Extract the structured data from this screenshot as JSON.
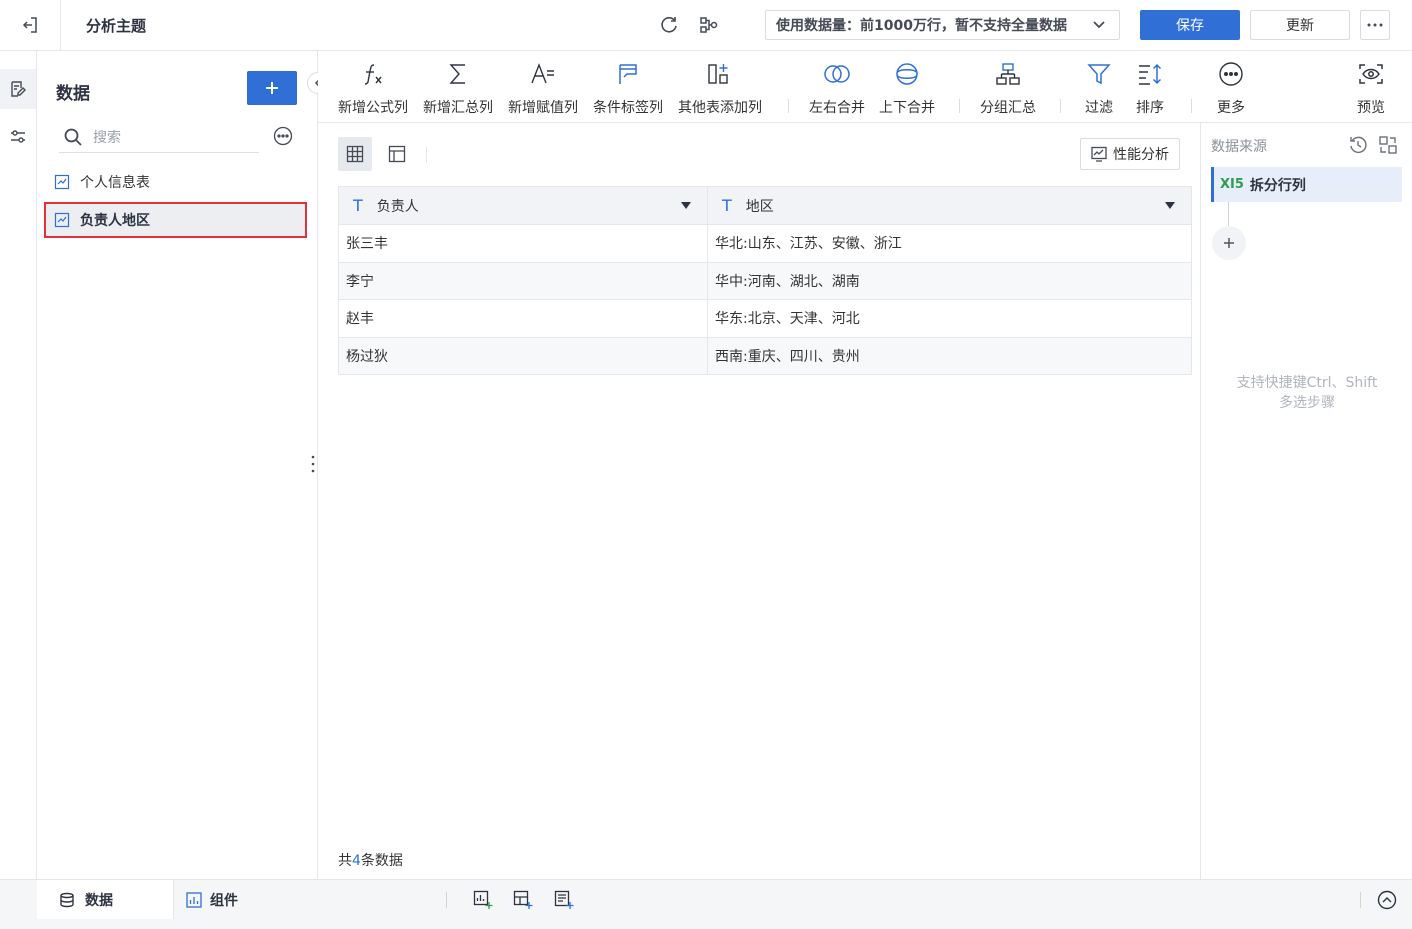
{
  "header": {
    "title": "分析主题",
    "data_volume": "使用数据量：前1000万行，暂不支持全量数据",
    "save_label": "保存",
    "update_label": "更新"
  },
  "data_panel": {
    "title": "数据",
    "search_placeholder": "搜索",
    "items": [
      {
        "label": "个人信息表"
      },
      {
        "label": "负责人地区"
      }
    ]
  },
  "toolbar": {
    "items": [
      {
        "label": "新增公式列",
        "icon": "formula-icon"
      },
      {
        "label": "新增汇总列",
        "icon": "sigma-icon"
      },
      {
        "label": "新增赋值列",
        "icon": "assign-icon"
      },
      {
        "label": "条件标签列",
        "icon": "flag-icon"
      },
      {
        "label": "其他表添加列",
        "icon": "add-column-icon"
      },
      {
        "label": "左右合并",
        "icon": "merge-horizontal-icon"
      },
      {
        "label": "上下合并",
        "icon": "merge-vertical-icon"
      },
      {
        "label": "分组汇总",
        "icon": "group-icon"
      },
      {
        "label": "过滤",
        "icon": "filter-icon"
      },
      {
        "label": "排序",
        "icon": "sort-icon"
      },
      {
        "label": "更多",
        "icon": "more-icon"
      },
      {
        "label": "预览",
        "icon": "preview-icon"
      }
    ]
  },
  "main": {
    "perf_label": "性能分析",
    "columns": [
      "负责人",
      "地区"
    ],
    "rows": [
      [
        "张三丰",
        "华北:山东、江苏、安徽、浙江"
      ],
      [
        "李宁",
        "华中:河南、湖北、湖南"
      ],
      [
        "赵丰",
        "华东:北京、天津、河北"
      ],
      [
        "杨过狄",
        "西南:重庆、四川、贵州"
      ]
    ],
    "count_prefix": "共",
    "count_value": "4",
    "count_suffix": "条数据"
  },
  "right_panel": {
    "title": "数据来源",
    "step_icon_text": "XI5",
    "step_label": "拆分行列",
    "hint_line1": "支持快捷键Ctrl、Shift",
    "hint_line2": "多选步骤"
  },
  "bottom": {
    "tab_data": "数据",
    "tab_component": "组件"
  },
  "colors": {
    "primary": "#2f6fd6",
    "highlight_border": "#e2313b",
    "excel_green": "#2e9d4f"
  }
}
